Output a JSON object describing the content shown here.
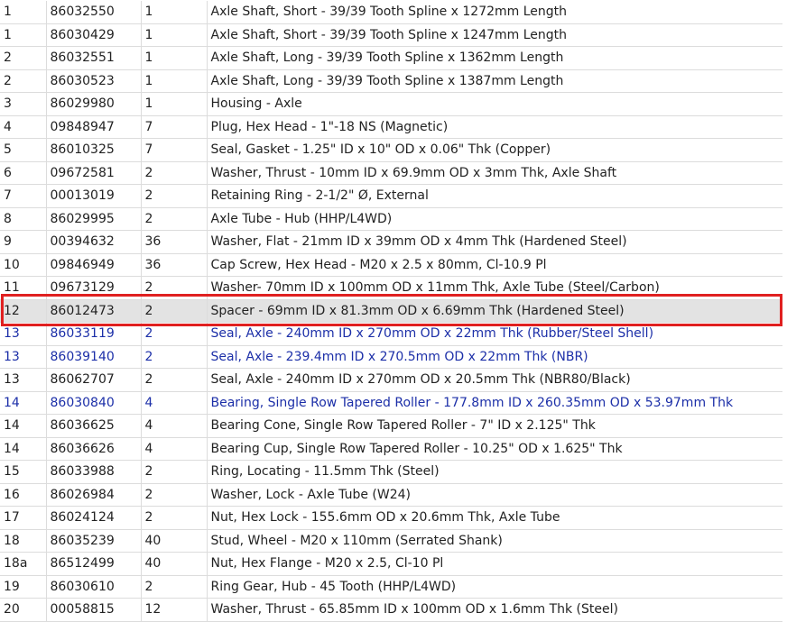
{
  "accent_colors": {
    "link_row_text": "#1c2fa8",
    "highlight_row_bg": "#e3e3e3",
    "highlight_outline": "#e02020"
  },
  "rows": [
    {
      "ref": "1",
      "part": "86032550",
      "qty": "1",
      "desc": "Axle Shaft, Short - 39/39 Tooth Spline x 1272mm Length",
      "style": "normal"
    },
    {
      "ref": "1",
      "part": "86030429",
      "qty": "1",
      "desc": "Axle Shaft, Short - 39/39 Tooth Spline x 1247mm Length",
      "style": "normal"
    },
    {
      "ref": "2",
      "part": "86032551",
      "qty": "1",
      "desc": "Axle Shaft, Long - 39/39 Tooth Spline x 1362mm Length",
      "style": "normal"
    },
    {
      "ref": "2",
      "part": "86030523",
      "qty": "1",
      "desc": "Axle Shaft, Long - 39/39 Tooth Spline x 1387mm Length",
      "style": "normal"
    },
    {
      "ref": "3",
      "part": "86029980",
      "qty": "1",
      "desc": "Housing - Axle",
      "style": "normal"
    },
    {
      "ref": "4",
      "part": "09848947",
      "qty": "7",
      "desc": "Plug, Hex Head - 1\"-18 NS (Magnetic)",
      "style": "normal"
    },
    {
      "ref": "5",
      "part": "86010325",
      "qty": "7",
      "desc": "Seal, Gasket - 1.25\" ID x 10\" OD x 0.06\" Thk (Copper)",
      "style": "normal"
    },
    {
      "ref": "6",
      "part": "09672581",
      "qty": "2",
      "desc": "Washer, Thrust - 10mm ID x 69.9mm OD x 3mm Thk, Axle Shaft",
      "style": "normal"
    },
    {
      "ref": "7",
      "part": "00013019",
      "qty": "2",
      "desc": "Retaining Ring - 2-1/2\" Ø, External",
      "style": "normal"
    },
    {
      "ref": "8",
      "part": "86029995",
      "qty": "2",
      "desc": "Axle Tube - Hub (HHP/L4WD)",
      "style": "normal"
    },
    {
      "ref": "9",
      "part": "00394632",
      "qty": "36",
      "desc": "Washer, Flat - 21mm ID x 39mm OD x 4mm Thk (Hardened Steel)",
      "style": "normal"
    },
    {
      "ref": "10",
      "part": "09846949",
      "qty": "36",
      "desc": "Cap Screw, Hex Head - M20 x 2.5 x 80mm, Cl-10.9 Pl",
      "style": "normal"
    },
    {
      "ref": "11",
      "part": "09673129",
      "qty": "2",
      "desc": "Washer- 70mm ID x 100mm OD x 11mm Thk, Axle Tube (Steel/Carbon)",
      "style": "normal"
    },
    {
      "ref": "12",
      "part": "86012473",
      "qty": "2",
      "desc": "Spacer - 69mm ID x 81.3mm OD x 6.69mm Thk (Hardened Steel)",
      "style": "highlight"
    },
    {
      "ref": "13",
      "part": "86033119",
      "qty": "2",
      "desc": "Seal, Axle - 240mm ID x 270mm OD x 22mm Thk (Rubber/Steel Shell)",
      "style": "link"
    },
    {
      "ref": "13",
      "part": "86039140",
      "qty": "2",
      "desc": "Seal, Axle - 239.4mm ID x 270.5mm OD x 22mm Thk (NBR)",
      "style": "link"
    },
    {
      "ref": "13",
      "part": "86062707",
      "qty": "2",
      "desc": "Seal, Axle - 240mm ID x 270mm OD x 20.5mm Thk (NBR80/Black)",
      "style": "normal"
    },
    {
      "ref": "14",
      "part": "86030840",
      "qty": "4",
      "desc": "Bearing, Single Row Tapered Roller - 177.8mm ID x 260.35mm OD x 53.97mm Thk",
      "style": "link"
    },
    {
      "ref": "14",
      "part": "86036625",
      "qty": "4",
      "desc": "Bearing Cone, Single Row Tapered Roller - 7\" ID x 2.125\" Thk",
      "style": "normal"
    },
    {
      "ref": "14",
      "part": "86036626",
      "qty": "4",
      "desc": "Bearing Cup, Single Row Tapered Roller - 10.25\" OD x 1.625\" Thk",
      "style": "normal"
    },
    {
      "ref": "15",
      "part": "86033988",
      "qty": "2",
      "desc": "Ring, Locating - 11.5mm Thk (Steel)",
      "style": "normal"
    },
    {
      "ref": "16",
      "part": "86026984",
      "qty": "2",
      "desc": "Washer, Lock - Axle Tube (W24)",
      "style": "normal"
    },
    {
      "ref": "17",
      "part": "86024124",
      "qty": "2",
      "desc": "Nut, Hex Lock - 155.6mm OD x 20.6mm Thk, Axle Tube",
      "style": "normal"
    },
    {
      "ref": "18",
      "part": "86035239",
      "qty": "40",
      "desc": "Stud, Wheel - M20 x 110mm (Serrated Shank)",
      "style": "normal"
    },
    {
      "ref": "18a",
      "part": "86512499",
      "qty": "40",
      "desc": "Nut, Hex Flange - M20 x 2.5, Cl-10 Pl",
      "style": "normal"
    },
    {
      "ref": "19",
      "part": "86030610",
      "qty": "2",
      "desc": "Ring Gear, Hub - 45 Tooth (HHP/L4WD)",
      "style": "normal"
    },
    {
      "ref": "20",
      "part": "00058815",
      "qty": "12",
      "desc": "Washer, Thrust - 65.85mm ID x 100mm OD x 1.6mm Thk (Steel)",
      "style": "normal"
    }
  ]
}
